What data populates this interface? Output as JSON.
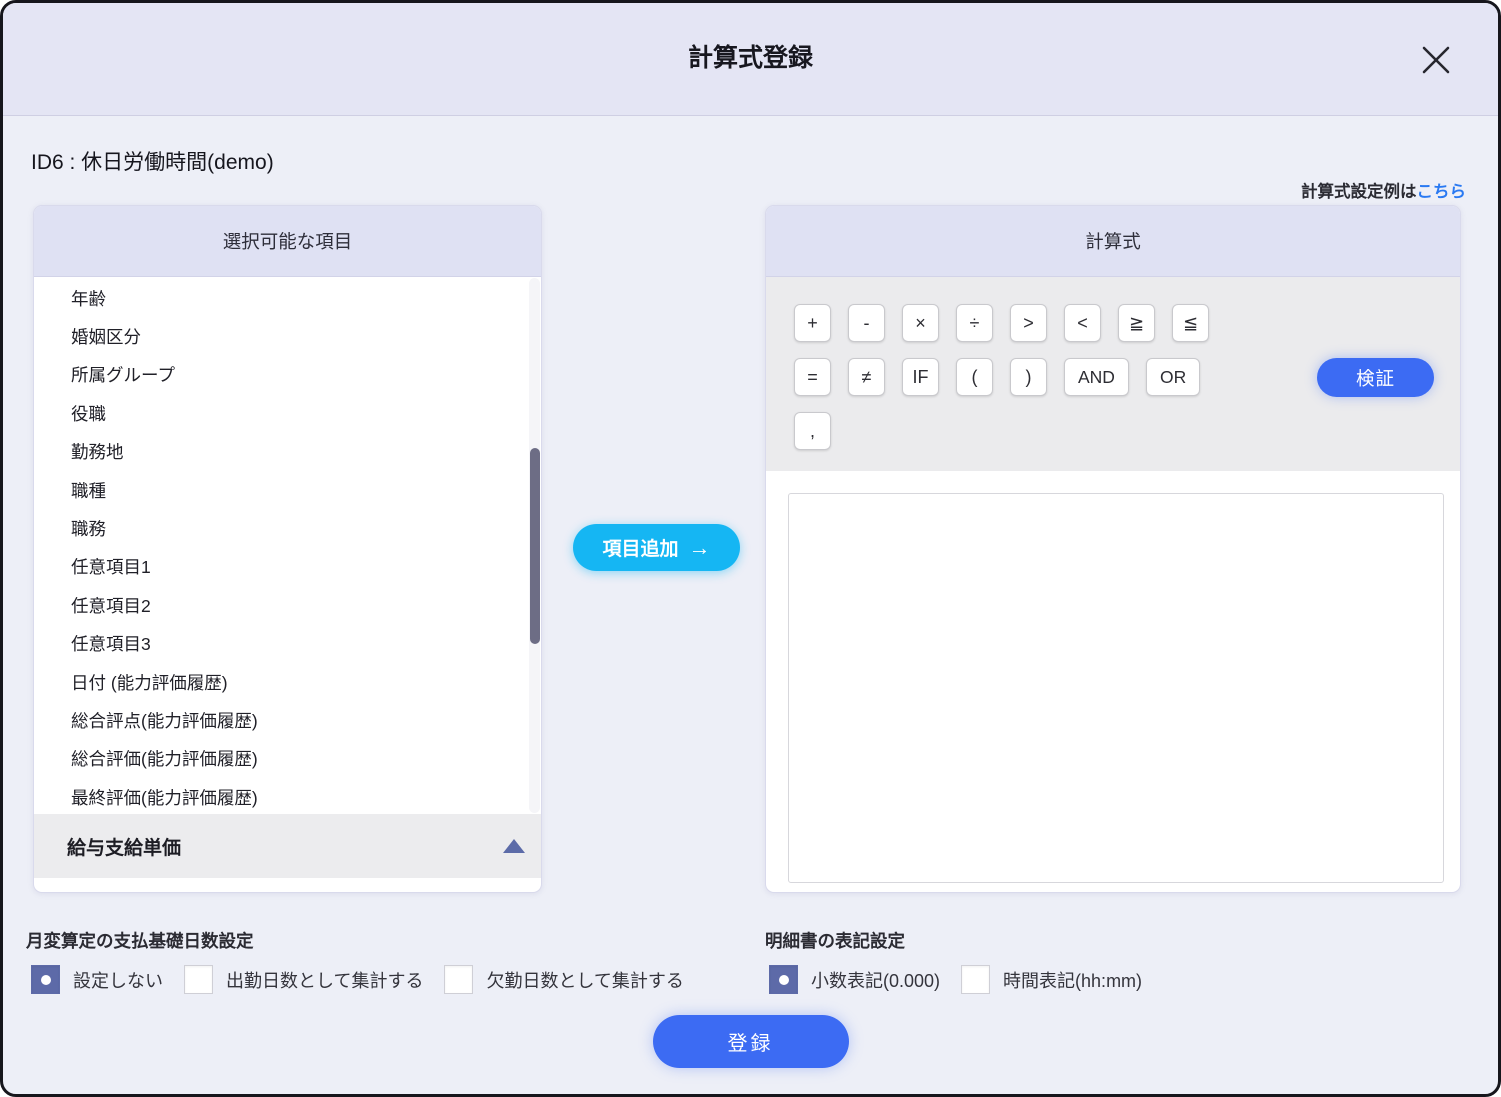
{
  "modal": {
    "title": "計算式登録",
    "subtitle": "ID6 : 休日労働時間(demo)",
    "example_link_prefix": "計算式設定例は",
    "example_link_text": "こちら"
  },
  "left_panel": {
    "header": "選択可能な項目",
    "items": [
      "年齢",
      "婚姻区分",
      "所属グループ",
      "役職",
      "勤務地",
      "職種",
      "職務",
      "任意項目1",
      "任意項目2",
      "任意項目3",
      "日付 (能力評価履歴)",
      "総合評点(能力評価履歴)",
      "総合評価(能力評価履歴)",
      "最終評価(能力評価履歴)"
    ],
    "collapsed_section_label": "給与支給単価"
  },
  "add_button": {
    "label": "項目追加",
    "arrow": "→"
  },
  "right_panel": {
    "header": "計算式",
    "operators_row1": [
      "+",
      "-",
      "×",
      "÷",
      ">",
      "<",
      "≧",
      "≦"
    ],
    "operators_row2": [
      "=",
      "≠",
      "IF",
      "(",
      ")",
      "AND",
      "OR"
    ],
    "operators_row3": [
      ","
    ],
    "verify_button": "検証",
    "formula_value": ""
  },
  "settings": {
    "payment_days": {
      "label": "月変算定の支払基礎日数設定",
      "options": [
        {
          "label": "設定しない",
          "selected": true
        },
        {
          "label": "出勤日数として集計する",
          "selected": false
        },
        {
          "label": "欠勤日数として集計する",
          "selected": false
        }
      ]
    },
    "statement_format": {
      "label": "明細書の表記設定",
      "options": [
        {
          "label": "小数表記(0.000)",
          "selected": true
        },
        {
          "label": "時間表記(hh:mm)",
          "selected": false
        }
      ]
    }
  },
  "submit_button": "登録",
  "colors": {
    "header_bg": "#e4e5f4",
    "body_bg": "#edeff7",
    "panel_header_bg": "#dfe1f3",
    "cyan_accent": "#15b6f3",
    "blue_accent": "#3c6bf3",
    "link_blue": "#2979f2",
    "radio_checked": "#5d6aa8",
    "scrollbar_thumb": "#6d6d85"
  }
}
